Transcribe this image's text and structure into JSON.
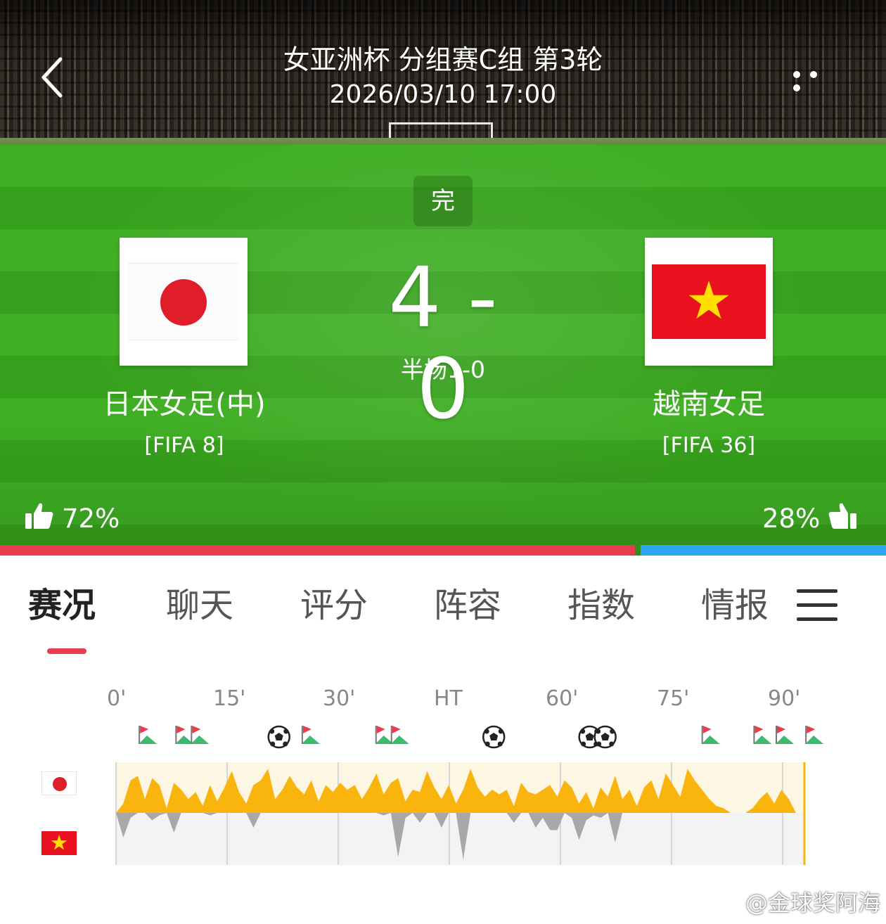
{
  "header": {
    "title": "女亚洲杯 分组赛C组 第3轮",
    "datetime": "2026/03/10 17:00",
    "back_icon": "chevron-left-icon",
    "more_icon": "more-dots-icon"
  },
  "match": {
    "status": "完",
    "home_score": "4",
    "separator": "-",
    "away_score": "0",
    "halftime": "半场1-0"
  },
  "home_team": {
    "name": "日本女足(中)",
    "rank": "[FIFA 8]",
    "flag": "japan-flag",
    "vote_percent": "72%",
    "vote_value": 72,
    "color": "#ea3c4f"
  },
  "away_team": {
    "name": "越南女足",
    "rank": "[FIFA 36]",
    "flag": "vietnam-flag",
    "vote_percent": "28%",
    "vote_value": 28,
    "color": "#2aa7ee"
  },
  "tabs": [
    {
      "label": "赛况",
      "active": true
    },
    {
      "label": "聊天",
      "active": false
    },
    {
      "label": "评分",
      "active": false
    },
    {
      "label": "阵容",
      "active": false
    },
    {
      "label": "指数",
      "active": false
    },
    {
      "label": "情报",
      "active": false
    }
  ],
  "tab_menu_icon": "hamburger-menu-icon",
  "timeline": {
    "ticks": [
      "0'",
      "15'",
      "30'",
      "HT",
      "60'",
      "75'",
      "90'"
    ],
    "home_color": "#f9b50e",
    "away_color": "#a8a8a8",
    "events": [
      {
        "type": "corner",
        "count": 1,
        "minute": 4
      },
      {
        "type": "corner",
        "count": 2,
        "minute": 10
      },
      {
        "type": "goal",
        "count": 1,
        "minute": 22
      },
      {
        "type": "corner",
        "count": 1,
        "minute": 26
      },
      {
        "type": "corner",
        "count": 2,
        "minute": 37
      },
      {
        "type": "goal",
        "count": 1,
        "minute": 51
      },
      {
        "type": "goal",
        "count": 2,
        "minute": 65
      },
      {
        "type": "corner",
        "count": 1,
        "minute": 80
      },
      {
        "type": "corner",
        "count": 1,
        "minute": 87
      },
      {
        "type": "corner",
        "count": 1,
        "minute": 90
      },
      {
        "type": "corner",
        "count": 1,
        "minute": 94
      }
    ]
  },
  "watermark": "@金球奖阿海"
}
